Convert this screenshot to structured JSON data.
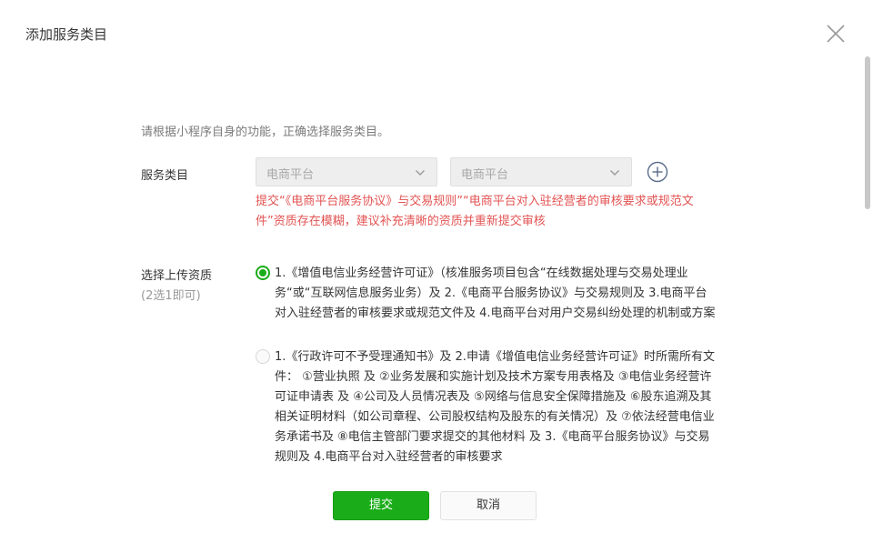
{
  "dialog": {
    "title": "添加服务类目"
  },
  "intro": "请根据小程序自身的功能，正确选择服务类目。",
  "category": {
    "label": "服务类目",
    "primary_value": "电商平台",
    "secondary_value": "电商平台",
    "error": "提交“《电商平台服务协议》与交易规则”“电商平台对入驻经营者的审核要求或规范文件”资质存在模糊，建议补充清晰的资质并重新提交审核"
  },
  "qualification": {
    "label": "选择上传资质",
    "sublabel": "(2选1即可)",
    "options": [
      {
        "text": "1.《增值电信业务经营许可证》（核准服务项目包含“在线数据处理与交易处理业务“或“互联网信息服务业务）及 2.《电商平台服务协议》与交易规则及 3.电商平台对入驻经营者的审核要求或规范文件及 4.电商平台对用户交易纠纷处理的机制或方案",
        "selected": true
      },
      {
        "text": "1.《行政许可不予受理通知书》及 2.申请《增值电信业务经营许可证》时所需所有文件： ①营业执照 及 ②业务发展和实施计划及技术方案专用表格及 ③电信业务经营许可证申请表 及 ④公司及人员情况表及 ⑤网络与信息安全保障措施及 ⑥股东追溯及其相关证明材料（如公司章程、公司股权结构及股东的有关情况）及 ⑦依法经营电信业务承诺书及 ⑧电信主管部门要求提交的其他材料 及 3.《电商平台服务协议》与交易规则及 4.电商平台对入驻经营者的审核要求",
        "selected": false
      }
    ]
  },
  "buttons": {
    "submit": "提交",
    "cancel": "取消"
  },
  "colors": {
    "primary": "#1aad19",
    "error": "#e35353"
  }
}
